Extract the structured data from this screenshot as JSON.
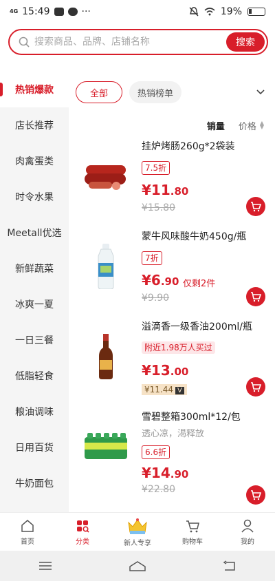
{
  "status": {
    "network": "4G",
    "time": "15:49",
    "battery": "19%"
  },
  "search": {
    "placeholder": "搜索商品、品牌、店铺名称",
    "button": "搜索"
  },
  "sidebar": {
    "items": [
      {
        "label": "热销爆款",
        "active": true
      },
      {
        "label": "店长推荐"
      },
      {
        "label": "肉禽蛋类"
      },
      {
        "label": "时令水果"
      },
      {
        "label": "Meetall优选"
      },
      {
        "label": "新鲜蔬菜"
      },
      {
        "label": "冰爽一夏"
      },
      {
        "label": "一日三餐"
      },
      {
        "label": "低脂轻食"
      },
      {
        "label": "粮油调味"
      },
      {
        "label": "日用百货"
      },
      {
        "label": "牛奶面包"
      }
    ]
  },
  "filters": {
    "all": "全部",
    "hot": "热销榜单"
  },
  "sort": {
    "sales": "销量",
    "price": "价格"
  },
  "products": [
    {
      "name": "挂炉烤肠260g*2袋装",
      "discount": "7.5折",
      "currency": "¥",
      "price_int": "11",
      "price_dec": ".80",
      "old_price": "¥15.80"
    },
    {
      "name": "蒙牛风味酸牛奶450g/瓶",
      "discount": "7折",
      "currency": "¥",
      "price_int": "6",
      "price_dec": ".90",
      "stock": "仅剩2件",
      "old_price": "¥9.90"
    },
    {
      "name": "溢滴香一级香油200ml/瓶",
      "badge": "附近1.98万人买过",
      "currency": "¥",
      "price_int": "13",
      "price_dec": ".00",
      "member_price": "¥11.44",
      "member_tag": "V"
    },
    {
      "name": "雪碧整箱300ml*12/包",
      "desc": "透心凉，渴释放",
      "discount": "6.6折",
      "currency": "¥",
      "price_int": "14",
      "price_dec": ".90",
      "old_price": "¥22.80"
    }
  ],
  "tabs": [
    {
      "label": "首页",
      "icon": "home-icon"
    },
    {
      "label": "分类",
      "icon": "category-icon",
      "active": true
    },
    {
      "label": "新人专享",
      "icon": "gift-crown-icon"
    },
    {
      "label": "购物车",
      "icon": "cart-icon"
    },
    {
      "label": "我的",
      "icon": "user-icon"
    }
  ],
  "colors": {
    "accent": "#d81e2a"
  }
}
